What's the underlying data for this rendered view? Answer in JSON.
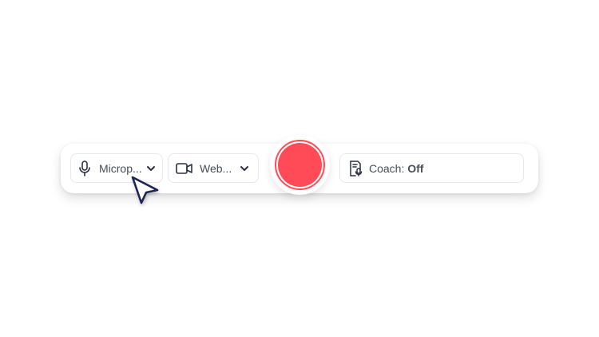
{
  "toolbar": {
    "microphone": {
      "label": "Microp...",
      "icon": "microphone-icon"
    },
    "webcam": {
      "label": "Web...",
      "icon": "video-camera-icon"
    },
    "record": {
      "icon": "record-dot"
    },
    "coach": {
      "label": "Coach: ",
      "state": "Off",
      "icon": "coach-icon"
    }
  },
  "colors": {
    "record": "#ff4b57",
    "text": "#4a4d5a",
    "border": "#e6e7ec",
    "cursor": "#1f2452"
  }
}
